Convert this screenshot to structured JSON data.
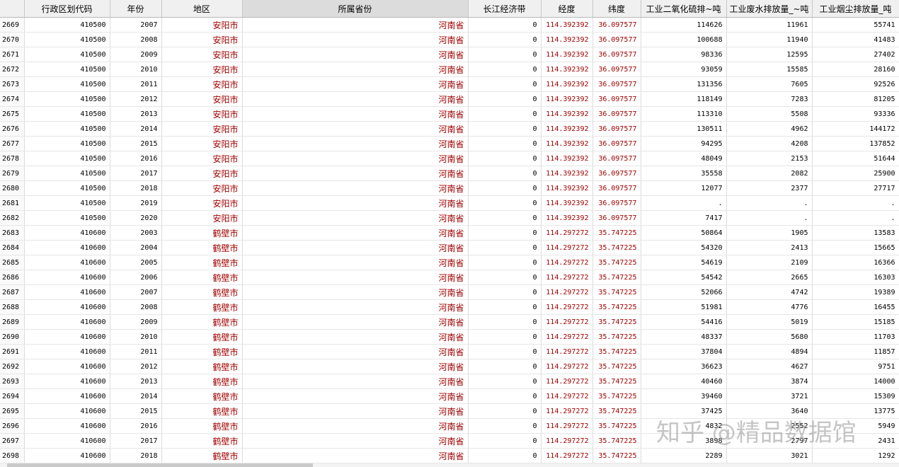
{
  "columns": [
    "",
    "行政区划代码",
    "年份",
    "地区",
    "所属省份",
    "长江经济带",
    "经度",
    "纬度",
    "工业二氧化硫排~吨",
    "工业废水排放量_~吨",
    "工业烟尘排放量_吨"
  ],
  "rows": [
    [
      "2669",
      "410500",
      "2007",
      "安阳市",
      "河南省",
      "0",
      "114.392392",
      "36.097577",
      "114626",
      "11961",
      "55741"
    ],
    [
      "2670",
      "410500",
      "2008",
      "安阳市",
      "河南省",
      "0",
      "114.392392",
      "36.097577",
      "100688",
      "11940",
      "41483"
    ],
    [
      "2671",
      "410500",
      "2009",
      "安阳市",
      "河南省",
      "0",
      "114.392392",
      "36.097577",
      "98336",
      "12595",
      "27402"
    ],
    [
      "2672",
      "410500",
      "2010",
      "安阳市",
      "河南省",
      "0",
      "114.392392",
      "36.097577",
      "93059",
      "15585",
      "28160"
    ],
    [
      "2673",
      "410500",
      "2011",
      "安阳市",
      "河南省",
      "0",
      "114.392392",
      "36.097577",
      "131356",
      "7605",
      "92526"
    ],
    [
      "2674",
      "410500",
      "2012",
      "安阳市",
      "河南省",
      "0",
      "114.392392",
      "36.097577",
      "118149",
      "7283",
      "81205"
    ],
    [
      "2675",
      "410500",
      "2013",
      "安阳市",
      "河南省",
      "0",
      "114.392392",
      "36.097577",
      "113310",
      "5508",
      "93336"
    ],
    [
      "2676",
      "410500",
      "2014",
      "安阳市",
      "河南省",
      "0",
      "114.392392",
      "36.097577",
      "130511",
      "4962",
      "144172"
    ],
    [
      "2677",
      "410500",
      "2015",
      "安阳市",
      "河南省",
      "0",
      "114.392392",
      "36.097577",
      "94295",
      "4208",
      "137852"
    ],
    [
      "2678",
      "410500",
      "2016",
      "安阳市",
      "河南省",
      "0",
      "114.392392",
      "36.097577",
      "48049",
      "2153",
      "51644"
    ],
    [
      "2679",
      "410500",
      "2017",
      "安阳市",
      "河南省",
      "0",
      "114.392392",
      "36.097577",
      "35558",
      "2082",
      "25900"
    ],
    [
      "2680",
      "410500",
      "2018",
      "安阳市",
      "河南省",
      "0",
      "114.392392",
      "36.097577",
      "12077",
      "2377",
      "27717"
    ],
    [
      "2681",
      "410500",
      "2019",
      "安阳市",
      "河南省",
      "0",
      "114.392392",
      "36.097577",
      ".",
      ".",
      "."
    ],
    [
      "2682",
      "410500",
      "2020",
      "安阳市",
      "河南省",
      "0",
      "114.392392",
      "36.097577",
      "7417",
      ".",
      "."
    ],
    [
      "2683",
      "410600",
      "2003",
      "鹤壁市",
      "河南省",
      "0",
      "114.297272",
      "35.747225",
      "50864",
      "1905",
      "13583"
    ],
    [
      "2684",
      "410600",
      "2004",
      "鹤壁市",
      "河南省",
      "0",
      "114.297272",
      "35.747225",
      "54320",
      "2413",
      "15665"
    ],
    [
      "2685",
      "410600",
      "2005",
      "鹤壁市",
      "河南省",
      "0",
      "114.297272",
      "35.747225",
      "54619",
      "2109",
      "16366"
    ],
    [
      "2686",
      "410600",
      "2006",
      "鹤壁市",
      "河南省",
      "0",
      "114.297272",
      "35.747225",
      "54542",
      "2665",
      "16303"
    ],
    [
      "2687",
      "410600",
      "2007",
      "鹤壁市",
      "河南省",
      "0",
      "114.297272",
      "35.747225",
      "52066",
      "4742",
      "19389"
    ],
    [
      "2688",
      "410600",
      "2008",
      "鹤壁市",
      "河南省",
      "0",
      "114.297272",
      "35.747225",
      "51981",
      "4776",
      "16455"
    ],
    [
      "2689",
      "410600",
      "2009",
      "鹤壁市",
      "河南省",
      "0",
      "114.297272",
      "35.747225",
      "54416",
      "5019",
      "15185"
    ],
    [
      "2690",
      "410600",
      "2010",
      "鹤壁市",
      "河南省",
      "0",
      "114.297272",
      "35.747225",
      "48337",
      "5680",
      "11703"
    ],
    [
      "2691",
      "410600",
      "2011",
      "鹤壁市",
      "河南省",
      "0",
      "114.297272",
      "35.747225",
      "37804",
      "4894",
      "11857"
    ],
    [
      "2692",
      "410600",
      "2012",
      "鹤壁市",
      "河南省",
      "0",
      "114.297272",
      "35.747225",
      "36623",
      "4627",
      "9751"
    ],
    [
      "2693",
      "410600",
      "2013",
      "鹤壁市",
      "河南省",
      "0",
      "114.297272",
      "35.747225",
      "40460",
      "3874",
      "14000"
    ],
    [
      "2694",
      "410600",
      "2014",
      "鹤壁市",
      "河南省",
      "0",
      "114.297272",
      "35.747225",
      "39460",
      "3721",
      "15309"
    ],
    [
      "2695",
      "410600",
      "2015",
      "鹤壁市",
      "河南省",
      "0",
      "114.297272",
      "35.747225",
      "37425",
      "3640",
      "13775"
    ],
    [
      "2696",
      "410600",
      "2016",
      "鹤壁市",
      "河南省",
      "0",
      "114.297272",
      "35.747225",
      "4832",
      "2552",
      "5949"
    ],
    [
      "2697",
      "410600",
      "2017",
      "鹤壁市",
      "河南省",
      "0",
      "114.297272",
      "35.747225",
      "3898",
      "2797",
      "2431"
    ],
    [
      "2698",
      "410600",
      "2018",
      "鹤壁市",
      "河南省",
      "0",
      "114.297272",
      "35.747225",
      "2289",
      "3021",
      "1292"
    ]
  ],
  "watermark": "知乎 @精品数据馆",
  "colors": {
    "text_red": "#a00000",
    "header_bg": "#f0f0f0",
    "grid_line": "#dcdcdc"
  }
}
